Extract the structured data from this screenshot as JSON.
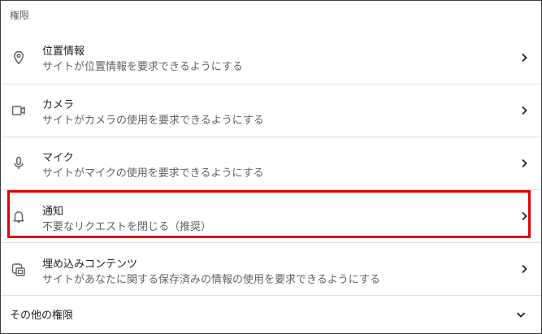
{
  "section_title": "権限",
  "items": [
    {
      "icon": "location-pin-icon",
      "title": "位置情報",
      "subtitle": "サイトが位置情報を要求できるようにする"
    },
    {
      "icon": "camera-icon",
      "title": "カメラ",
      "subtitle": "サイトがカメラの使用を要求できるようにする"
    },
    {
      "icon": "microphone-icon",
      "title": "マイク",
      "subtitle": "サイトがマイクの使用を要求できるようにする"
    },
    {
      "icon": "bell-icon",
      "title": "通知",
      "subtitle": "不要なリクエストを閉じる（推奨）"
    },
    {
      "icon": "embedded-content-icon",
      "title": "埋め込みコンテンツ",
      "subtitle": "サイトがあなたに関する保存済みの情報の使用を要求できるようにする"
    }
  ],
  "more_permissions_label": "その他の権限",
  "highlight_color": "#e00000"
}
